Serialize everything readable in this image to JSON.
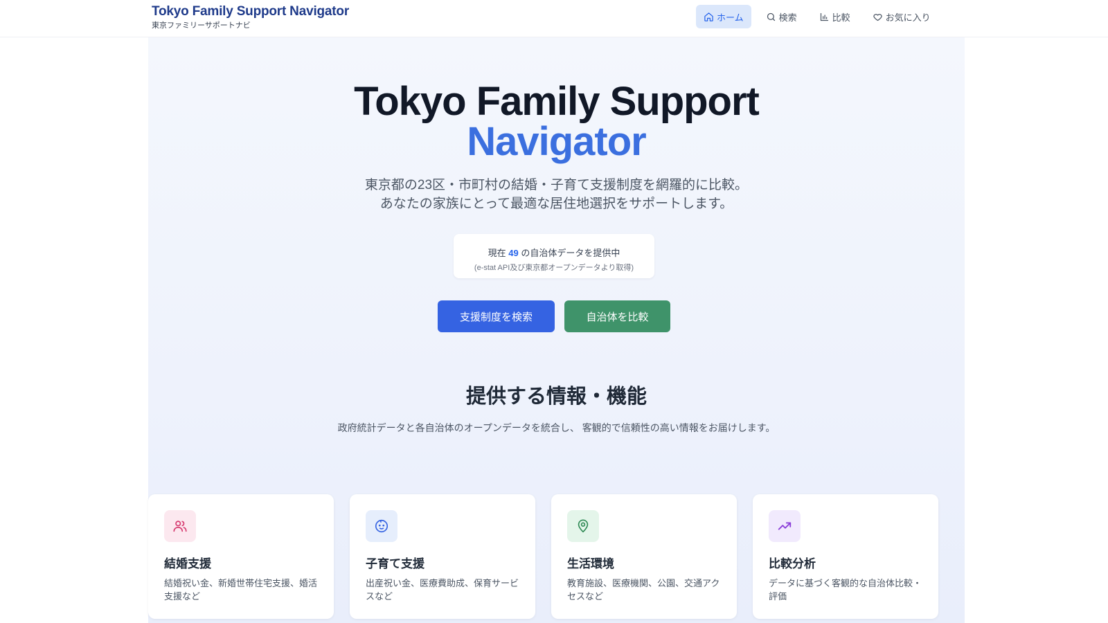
{
  "header": {
    "title": "Tokyo Family Support Navigator",
    "subtitle": "東京ファミリーサポートナビ",
    "nav": [
      {
        "label": "ホーム",
        "icon": "home-icon",
        "active": true
      },
      {
        "label": "検索",
        "icon": "search-icon",
        "active": false
      },
      {
        "label": "比較",
        "icon": "bar-chart-icon",
        "active": false
      },
      {
        "label": "お気に入り",
        "icon": "heart-icon",
        "active": false
      }
    ]
  },
  "hero": {
    "title_line1": "Tokyo Family Support",
    "title_line2": "Navigator",
    "desc_line1": "東京都の23区・市町村の結婚・子育て支援制度を網羅的に比較。",
    "desc_line2": "あなたの家族にとって最適な居住地選択をサポートします。",
    "stats_prefix": "現在",
    "stats_count": "49",
    "stats_suffix": "の自治体データを提供中",
    "stats_source": "(e-stat API及び東京都オープンデータより取得)",
    "btn_search": "支援制度を検索",
    "btn_compare": "自治体を比較"
  },
  "features": {
    "title": "提供する情報・機能",
    "desc": "政府統計データと各自治体のオープンデータを統合し、 客観的で信頼性の高い情報をお届けします。",
    "cards": [
      {
        "title": "結婚支援",
        "desc": "結婚祝い金、新婚世帯住宅支援、婚活支援など",
        "icon": "users-icon",
        "icon_bg": "#fce8ef",
        "icon_color": "#d63a6f"
      },
      {
        "title": "子育て支援",
        "desc": "出産祝い金、医療費助成、保育サービスなど",
        "icon": "baby-face-icon",
        "icon_bg": "#e6eefc",
        "icon_color": "#3563e2"
      },
      {
        "title": "生活環境",
        "desc": "教育施設、医療機関、公園、交通アクセスなど",
        "icon": "map-pin-icon",
        "icon_bg": "#e4f5ea",
        "icon_color": "#2f8a55"
      },
      {
        "title": "比較分析",
        "desc": "データに基づく客観的な自治体比較・評価",
        "icon": "trending-up-icon",
        "icon_bg": "#f1eafd",
        "icon_color": "#8b3fd9"
      }
    ]
  },
  "colors": {
    "brand": "#1e3a8a",
    "accent": "#3b6fdf",
    "search_button": "#3563e2",
    "compare_button": "#3f936a"
  }
}
